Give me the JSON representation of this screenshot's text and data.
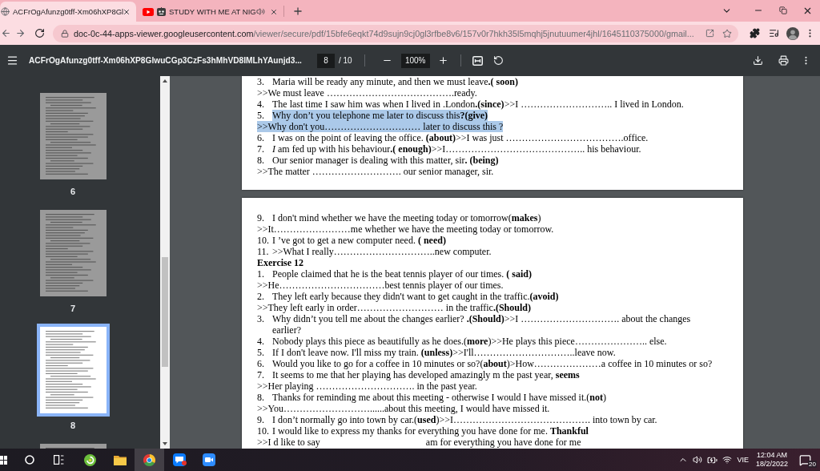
{
  "tabs": [
    {
      "kind": "document",
      "title": "ACFrOgAfunzg0tff-Xm06hXP8Gl",
      "selected": true,
      "audio": false
    },
    {
      "kind": "video",
      "title": "STUDY WITH ME AT NIG",
      "selected": false,
      "audio": true
    }
  ],
  "address_bar": {
    "host": "doc-0c-44-apps-viewer.googleusercontent.com",
    "path": "/viewer/secure/pdf/15bfe6eqkt74d9sujn9cj0gl3rfbe8v6/157v0r7hkh35l5mqhj5jnutuumer4jhl/1645110375000/gmail..."
  },
  "pdf_toolbar": {
    "title": "ACFrOgAfunzg0tff-Xm06hXP8GlwuCGp3CzFs3hMhVD8IMLhYAunjd3...",
    "page": "8",
    "page_count": "/ 10",
    "zoom": "100%"
  },
  "sidebar": {
    "thumbnails": [
      {
        "label": "6",
        "selected": false
      },
      {
        "label": "7",
        "selected": false
      },
      {
        "label": "8",
        "selected": true
      },
      {
        "selected": false
      }
    ]
  },
  "document": {
    "pages": [
      {
        "lines": [
          {
            "kind": "item",
            "num": "3.",
            "text": "Maria will be ready any minute, and then we must leave**.( soon)**",
            "highlighted": false
          },
          {
            "kind": "answer",
            "text": ">>We must leave ………………………………….ready.",
            "highlighted": false
          },
          {
            "kind": "item",
            "num": "4.",
            "text": "The last time I saw him was when I lived in .London**.(since)**>>I ……………………….. I lived in London.",
            "highlighted": false
          },
          {
            "kind": "item",
            "num": "5.",
            "text": "Why don’t you telephone me later to discuss this**?(give)**",
            "highlighted": true
          },
          {
            "kind": "answer",
            "text": ">>Why don't you………………………… later to discuss this ?",
            "highlighted": true
          },
          {
            "kind": "item",
            "num": "6.",
            "text": "I was on the point of leaving the office. **(about)**>>I was just ……………………………….office.",
            "highlighted": false
          },
          {
            "kind": "item",
            "num": "7.",
            "text": "*I* am fed up with his behaviour**.( enough)**>>I…………………………………….. his behaviour.",
            "highlighted": false
          },
          {
            "kind": "item",
            "num": "8.",
            "text": "Our senior manager is dealing with this matter, sir**. (being)**",
            "highlighted": false
          },
          {
            "kind": "answer",
            "text": ">>The matter ………………………. our senior manager, sir.",
            "highlighted": false
          }
        ]
      },
      {
        "lines": [
          {
            "kind": "item",
            "num": "9.",
            "text": "I don't mind whether we have the meeting today or tomorrow(**makes**)",
            "highlighted": false
          },
          {
            "kind": "answer",
            "text": ">>It……………………me whether we have the meeting today or tomorrow.",
            "highlighted": false
          },
          {
            "kind": "item",
            "num": "10.",
            "text": "I ’ve got to get a new computer need. **( need)**",
            "highlighted": false
          },
          {
            "kind": "item",
            "num": "11.",
            "text": ">>What I really…………………………..new computer.",
            "highlighted": false
          },
          {
            "kind": "heading",
            "text": "Exercise 12",
            "highlighted": false
          },
          {
            "kind": "item",
            "num": "1.",
            "text": "People claimed that he is the beat tennis player of our times. **( said)**",
            "highlighted": false
          },
          {
            "kind": "answer",
            "text": ">>He……………………………best tennis player of our times.",
            "highlighted": false
          },
          {
            "kind": "item",
            "num": "2.",
            "text": "They left early because they didn't want to get caught in the traffic.**(avoid)**",
            "highlighted": false
          },
          {
            "kind": "answer",
            "text": ">>They left early in order……………………… in the traffic**.(Should)**",
            "highlighted": false
          },
          {
            "kind": "item",
            "num": "3.",
            "text": "Why didn’t you tell me about the changes earlier? **.(Should)**>>I …………………………. about the changes\nearlier?",
            "highlighted": false
          },
          {
            "kind": "item",
            "num": "4.",
            "text": "Nobody plays this piece as beautifully as he does.(**more**)>>He plays this piece………………….. else.",
            "highlighted": false
          },
          {
            "kind": "item",
            "num": "5.",
            "text": "If I don't leave now. I'll miss my train. **(unless)**>>I'll…………………………..leave now.",
            "highlighted": false
          },
          {
            "kind": "item",
            "num": "6.",
            "text": "Would you like to go for a coffee in 10 minutes or so?(**about**)>How…………………a coffee in 10 minutes or so?",
            "highlighted": false
          },
          {
            "kind": "item",
            "num": "7.",
            "text": "It seems to me that her playing has developed amazingly m the past year, **seems**",
            "highlighted": false
          },
          {
            "kind": "answer",
            "text": ">>Her playing …………………………. in the past year.",
            "highlighted": false
          },
          {
            "kind": "item",
            "num": "8.",
            "text": "Thanks for reminding me about this meeting - otherwise I would I have missed it.(**not**)",
            "highlighted": false
          },
          {
            "kind": "answer",
            "text": ">>You………………………......about this meeting, I would have missed it.",
            "highlighted": false
          },
          {
            "kind": "item",
            "num": "9.",
            "text": "I don’t normally go into town by car.(**used**)>>I……………………………………. into town by car.",
            "highlighted": false
          },
          {
            "kind": "item",
            "num": "10.",
            "text": "I would like to express my thanks for everything you have done for me. **Thankful**",
            "highlighted": false
          },
          {
            "kind": "answer",
            "text": ">>I d like to say",
            "tail": "am for everything you have done for me",
            "highlighted": false
          }
        ]
      }
    ]
  },
  "taskbar": {
    "apps": [
      {
        "kind": "swirl",
        "selected": false,
        "badge": false
      },
      {
        "kind": "folder",
        "selected": false,
        "badge": false
      },
      {
        "kind": "browser",
        "selected": true,
        "badge": false
      },
      {
        "kind": "chat",
        "selected": false,
        "badge": true
      },
      {
        "kind": "meeting",
        "selected": false,
        "badge": false
      }
    ],
    "language": "VIE",
    "time": "12:04 AM",
    "date": "18/2/2022",
    "notifications": "20"
  }
}
